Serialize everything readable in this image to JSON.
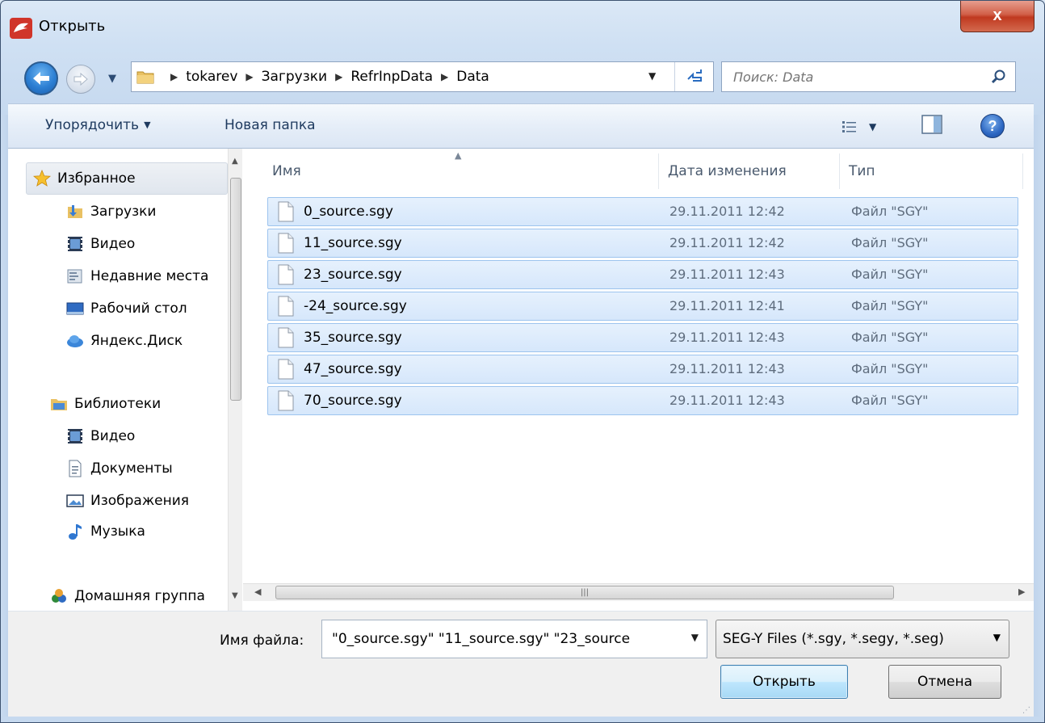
{
  "window": {
    "title": "Открыть",
    "close_label": "x"
  },
  "address": {
    "crumbs": [
      "tokarev",
      "Загрузки",
      "RefrInpData",
      "Data"
    ]
  },
  "search": {
    "placeholder": "Поиск: Data"
  },
  "toolbar": {
    "organize_label": "Упорядочить",
    "new_folder_label": "Новая папка"
  },
  "nav": {
    "favorites_label": "Избранное",
    "favorites_items": [
      "Загрузки",
      "Видео",
      "Недавние места",
      "Рабочий стол",
      "Яндекс.Диск"
    ],
    "libraries_label": "Библиотеки",
    "libraries_items": [
      "Видео",
      "Документы",
      "Изображения",
      "Музыка"
    ],
    "homegroup_label": "Домашняя группа"
  },
  "columns": {
    "name": "Имя",
    "date": "Дата изменения",
    "type": "Тип"
  },
  "files": [
    {
      "name": "0_source.sgy",
      "date": "29.11.2011 12:42",
      "type": "Файл \"SGY\""
    },
    {
      "name": "11_source.sgy",
      "date": "29.11.2011 12:42",
      "type": "Файл \"SGY\""
    },
    {
      "name": "23_source.sgy",
      "date": "29.11.2011 12:43",
      "type": "Файл \"SGY\""
    },
    {
      "name": "-24_source.sgy",
      "date": "29.11.2011 12:41",
      "type": "Файл \"SGY\""
    },
    {
      "name": "35_source.sgy",
      "date": "29.11.2011 12:43",
      "type": "Файл \"SGY\""
    },
    {
      "name": "47_source.sgy",
      "date": "29.11.2011 12:43",
      "type": "Файл \"SGY\""
    },
    {
      "name": "70_source.sgy",
      "date": "29.11.2011 12:43",
      "type": "Файл \"SGY\""
    }
  ],
  "bottom": {
    "filename_label": "Имя файла:",
    "filename_value": "\"0_source.sgy\" \"11_source.sgy\" \"23_source",
    "filter_value": "SEG-Y Files (*.sgy, *.segy, *.seg)",
    "open_label": "Открыть",
    "cancel_label": "Отмена"
  },
  "colors": {
    "selection_bg": "#d6e7fb",
    "selection_border": "#9dc4ee",
    "close_red": "#c0391f",
    "frame_blue": "#cfe0f3"
  }
}
